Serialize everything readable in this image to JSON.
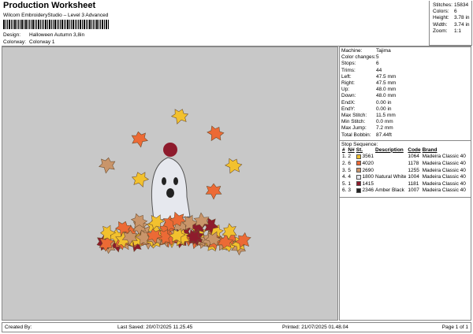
{
  "header": {
    "title": "Production Worksheet",
    "software": "Wilcom EmbroideryStudio – Level 3 Advanced",
    "design_label": "Design:",
    "design": "Halloween Autumn 3,8in",
    "colorway_label": "Colorway:",
    "colorway": "Colorway 1"
  },
  "stats": [
    {
      "label": "Stitches:",
      "value": "15834"
    },
    {
      "label": "Colors:",
      "value": "6"
    },
    {
      "label": "Height:",
      "value": "3.78 in"
    },
    {
      "label": "Width:",
      "value": "3.74 in"
    },
    {
      "label": "Zoom:",
      "value": "1:1"
    }
  ],
  "machine_info": [
    {
      "label": "Machine:",
      "value": "Tajima"
    },
    {
      "label": "Color changes:",
      "value": "5"
    },
    {
      "label": "Stops:",
      "value": "6"
    },
    {
      "label": "Trims:",
      "value": "44"
    },
    {
      "label": "Left:",
      "value": "47.5 mm"
    },
    {
      "label": "Right:",
      "value": "47.5 mm"
    },
    {
      "label": "Up:",
      "value": "48.0 mm"
    },
    {
      "label": "Down:",
      "value": "48.0 mm"
    },
    {
      "label": "EndX:",
      "value": "0.00 in"
    },
    {
      "label": "EndY:",
      "value": "0.00 in"
    },
    {
      "label": "Max Stitch:",
      "value": "11.5 mm"
    },
    {
      "label": "Min Stitch:",
      "value": "0.0 mm"
    },
    {
      "label": "Max Jump:",
      "value": "7.2 mm"
    },
    {
      "label": "Total Bobbin:",
      "value": "87.44ft"
    }
  ],
  "stop_sequence": {
    "title": "Stop Sequence:",
    "headers": [
      "#",
      "N#",
      "St.",
      "Description",
      "Code",
      "Brand"
    ],
    "rows": [
      {
        "n": "1.",
        "num": "2",
        "color": "#f2c12e",
        "st": "3561",
        "desc": "",
        "code": "1064",
        "brand": "Madeira Classic 40"
      },
      {
        "n": "2.",
        "num": "6",
        "color": "#ec6a35",
        "st": "4020",
        "desc": "",
        "code": "1178",
        "brand": "Madeira Classic 40"
      },
      {
        "n": "3.",
        "num": "5",
        "color": "#c9956a",
        "st": "2690",
        "desc": "",
        "code": "1255",
        "brand": "Madeira Classic 40"
      },
      {
        "n": "4.",
        "num": "4",
        "color": "#e6e8ee",
        "st": "1800",
        "desc": "Natural White",
        "code": "1004",
        "brand": "Madeira Classic 40"
      },
      {
        "n": "5.",
        "num": "1",
        "color": "#8e1b2c",
        "st": "1415",
        "desc": "",
        "code": "1181",
        "brand": "Madeira Classic 40"
      },
      {
        "n": "6.",
        "num": "3",
        "color": "#222222",
        "st": "2346",
        "desc": "Amber Black",
        "code": "1007",
        "brand": "Madeira Classic 40"
      }
    ]
  },
  "footer": {
    "created_by": "Created By:",
    "last_saved": "Last Saved: 20/07/2025 11.25.45",
    "printed": "Printed: 21/07/2025 01.48.04",
    "page": "Page 1 of 1"
  }
}
